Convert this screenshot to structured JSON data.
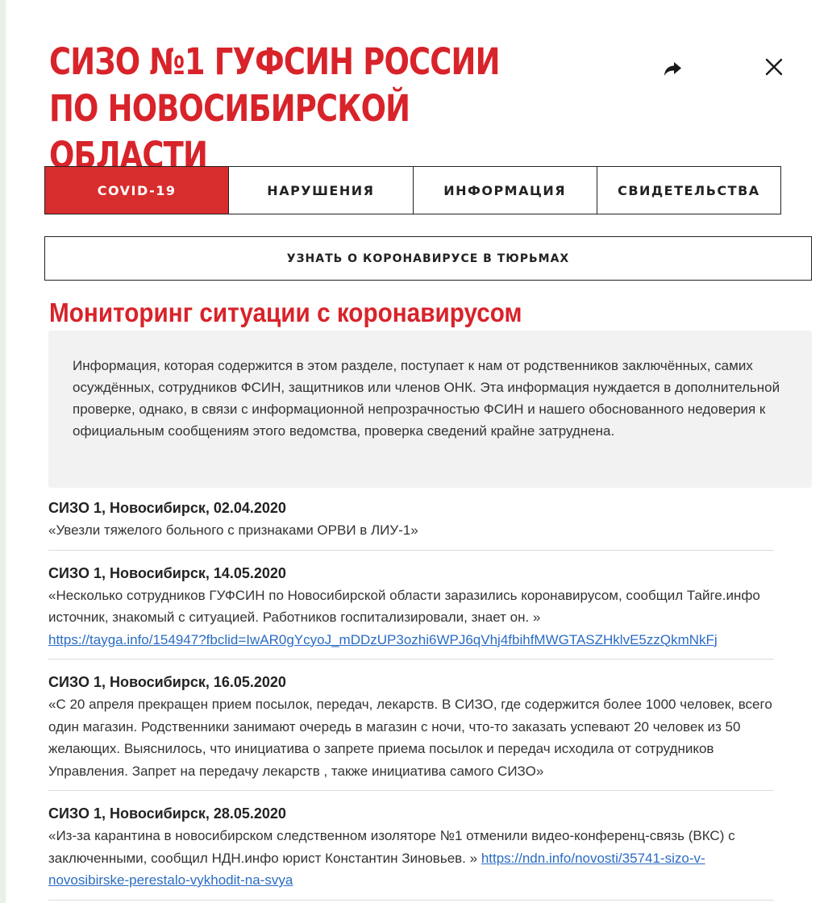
{
  "header": {
    "title": "СИЗО №1 ГУФСИН России по Новосибирской области"
  },
  "icons": {
    "share": "share-icon",
    "close": "close-icon"
  },
  "tabs": [
    {
      "label": "COVID-19",
      "active": true
    },
    {
      "label": "Нарушения",
      "active": false
    },
    {
      "label": "Информация",
      "active": false
    },
    {
      "label": "Свидетельства",
      "active": false
    }
  ],
  "learn_button": {
    "label": "Узнать о коронавирусе в тюрьмах"
  },
  "section": {
    "heading": "Мониторинг ситуации с коронавирусом",
    "notice": "Информация, которая содержится в этом разделе, поступает к нам от родственников заключённых, самих осуждённых, сотрудников ФСИН, защитников или членов ОНК. Эта информация нуждается в дополнительной проверке, однако, в связи с информационной непрозрачностью ФСИН и нашего обоснованного недоверия к официальным сообщениям этого ведомства, проверка сведений крайне затруднена."
  },
  "entries": [
    {
      "title": "СИЗО 1, Новосибирск, 02.04.2020",
      "text": "«Увезли тяжелого больного с признаками ОРВИ в ЛИУ-1»",
      "link": ""
    },
    {
      "title": "СИЗО 1, Новосибирск, 14.05.2020",
      "text": "«Несколько сотрудников ГУФСИН по Новосибирской области заразились коронавирусом, сообщил Тайге.инфо источник, знакомый с ситуацией. Работников госпитализировали, знает он. »",
      "link": "https://tayga.info/154947?fbclid=IwAR0gYcyoJ_mDDzUP3ozhi6WPJ6qVhj4fbihfMWGTASZHklvE5zzQkmNkFj"
    },
    {
      "title": "СИЗО 1, Новосибирск, 16.05.2020",
      "text": "«С 20 апреля прекращен прием посылок, передач, лекарств. В СИЗО, где содержится более 1000 человек, всего один магазин. Родственники занимают очередь в магазин с ночи, что-то заказать успевают 20 человек из 50 желающих. Выяснилось, что инициатива о запрете приема посылок и передач исходила от сотрудников Управления. Запрет на передачу лекарств , также инициатива самого СИЗО»",
      "link": ""
    },
    {
      "title": "СИЗО 1, Новосибирск, 28.05.2020",
      "text": "«Из-за карантина в новосибирском следственном изоляторе №1 отменили видео-конференц-связь (ВКС) с заключенными, сообщил НДН.инфо юрист Константин Зиновьев. »",
      "link": "https://ndn.info/novosti/35741-sizo-v-novosibirske-perestalo-vykhodit-na-svya"
    }
  ],
  "colors": {
    "accent": "#d8232a",
    "active_tab": "#d82d2d",
    "link": "#2a6cc4",
    "notice_bg": "#f2f2f2"
  }
}
